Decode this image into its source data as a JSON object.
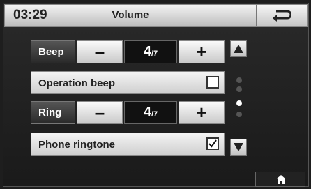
{
  "header": {
    "time": "03:29",
    "title": "Volume"
  },
  "rows": [
    {
      "label": "Beep",
      "minus": "–",
      "value": "4",
      "max": "/7",
      "plus": "+"
    },
    {
      "label": "Operation beep",
      "checked": false
    },
    {
      "label": "Ring",
      "minus": "–",
      "value": "4",
      "max": "/7",
      "plus": "+"
    },
    {
      "label": "Phone ringtone",
      "checked": true
    }
  ],
  "icons": {
    "back": "back-arrow-icon",
    "up": "up-triangle-icon",
    "down": "down-triangle-icon",
    "home": "home-icon"
  },
  "pagination": {
    "pages": 4,
    "active": 2
  }
}
